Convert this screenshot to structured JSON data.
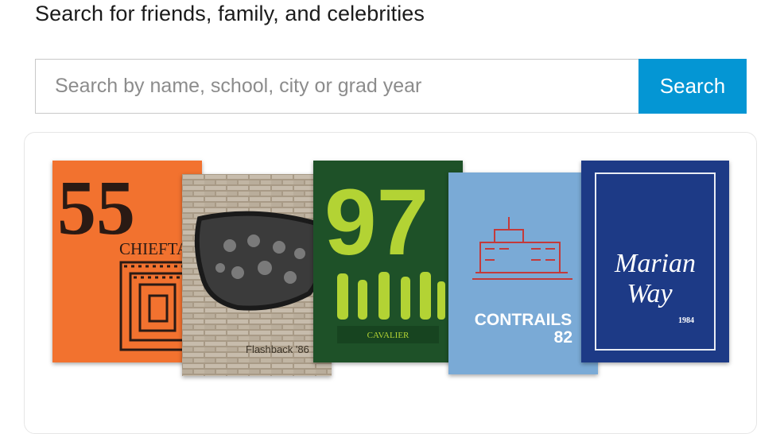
{
  "search": {
    "heading": "Search for friends, family, and celebrities",
    "placeholder": "Search by name, school, city or grad year",
    "button_label": "Search"
  },
  "yearbooks": [
    {
      "cover_text_1": "55",
      "cover_text_2": "CHIEFTAIN",
      "color": "#f2722f"
    },
    {
      "cover_text": "Flashback '86",
      "color": "#bdb2a2"
    },
    {
      "cover_text_1": "97",
      "cover_text_2": "CAVALIER",
      "color": "#1e5128"
    },
    {
      "cover_text_1": "CONTRAILS",
      "cover_text_2": "82",
      "color": "#7aaad6"
    },
    {
      "cover_text_1": "Marian",
      "cover_text_2": "Way",
      "cover_text_3": "1984",
      "color": "#1d3a86"
    }
  ]
}
